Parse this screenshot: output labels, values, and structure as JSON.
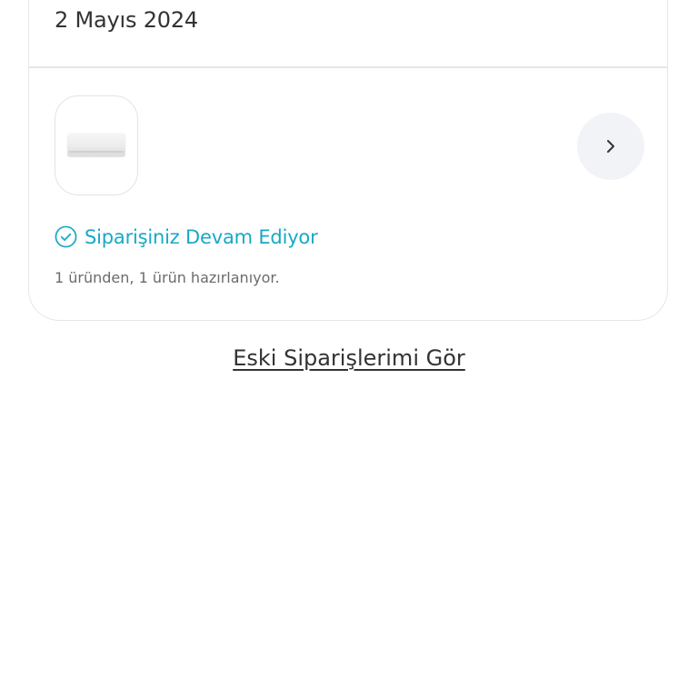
{
  "order": {
    "date": "2 Mayıs 2024",
    "status_text": "Siparişiniz Devam Ediyor",
    "status_detail": "1 üründen, 1 ürün hazırlanıyor.",
    "status_color": "#17a9c6",
    "product_image": "air-conditioner-icon",
    "detail_icon": "chevron-right-icon"
  },
  "links": {
    "old_orders": "Eski Siparişlerimi Gör"
  }
}
